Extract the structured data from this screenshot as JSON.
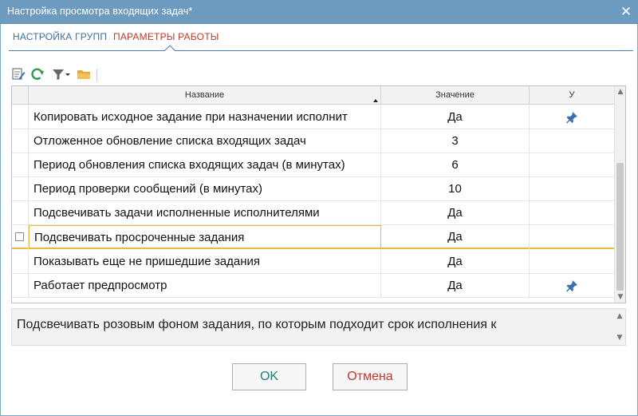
{
  "window": {
    "title": "Настройка просмотра входящих задач*",
    "close_glyph": "✕"
  },
  "tabs": [
    {
      "label": "НАСТРОЙКА ГРУПП"
    },
    {
      "label": "ПАРАМЕТРЫ РАБОТЫ",
      "active": true
    }
  ],
  "toolbar": {
    "icons": [
      "edit-icon",
      "refresh-icon",
      "filter-icon",
      "dropdown-arrow-icon",
      "folder-icon"
    ]
  },
  "grid": {
    "columns": {
      "name": "Название",
      "value": "Значение",
      "u": "У"
    },
    "rows": [
      {
        "name": "Копировать исходное задание при назначении исполнит",
        "value": "Да",
        "pinned": true
      },
      {
        "name": "Отложенное обновление списка входящих задач",
        "value": "3",
        "pinned": false
      },
      {
        "name": "Период обновления списка входящих задач (в минутах)",
        "value": "6",
        "pinned": false
      },
      {
        "name": "Период проверки сообщений (в минутах)",
        "value": "10",
        "pinned": false
      },
      {
        "name": "Подсвечивать задачи исполненные исполнителями",
        "value": "Да",
        "pinned": false
      },
      {
        "name": "Подсвечивать просроченные задания",
        "value": "Да",
        "pinned": false,
        "selected": true
      },
      {
        "name": "Показывать еще не пришедшие задания",
        "value": "Да",
        "pinned": false
      },
      {
        "name": "Работает предпросмотр",
        "value": "Да",
        "pinned": true
      }
    ]
  },
  "description": {
    "text": "Подсвечивать розовым фоном задания, по которым подходит срок исполнения к"
  },
  "buttons": {
    "ok_label": "OK",
    "cancel_label": "Отмена"
  },
  "colors": {
    "titlebar": "#6d9bbf",
    "tab_active": "#c0392b",
    "tab_inactive": "#3d6f9e",
    "selection": "#f0b83a",
    "pin": "#3a6fb0",
    "ok_text": "#1f7f75",
    "cancel_text": "#c0392b"
  }
}
